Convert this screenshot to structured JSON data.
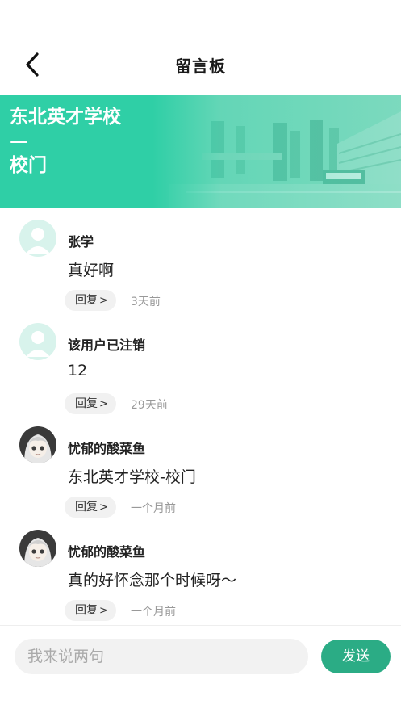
{
  "header": {
    "title": "留言板",
    "back_icon": "chevron-left-icon"
  },
  "banner": {
    "title": "东北英才学校\n—\n校门",
    "accent_color": "#2fcfa6"
  },
  "comments": [
    {
      "username": "张学",
      "content": "真好啊",
      "reply_label": "回复",
      "time": "3天前",
      "avatar": "default-user-avatar"
    },
    {
      "username": "该用户已注销",
      "content": "12",
      "reply_label": "回复",
      "time": "29天前",
      "avatar": "default-user-avatar"
    },
    {
      "username": "忧郁的酸菜鱼",
      "content": "东北英才学校-校门",
      "reply_label": "回复",
      "time": "一个月前",
      "avatar": "anime-girl-avatar"
    },
    {
      "username": "忧郁的酸菜鱼",
      "content": "真的好怀念那个时候呀～",
      "reply_label": "回复",
      "time": "一个月前",
      "avatar": "anime-girl-avatar"
    }
  ],
  "composer": {
    "placeholder": "我来说两句",
    "send_label": "发送",
    "send_color": "#2bac85"
  }
}
